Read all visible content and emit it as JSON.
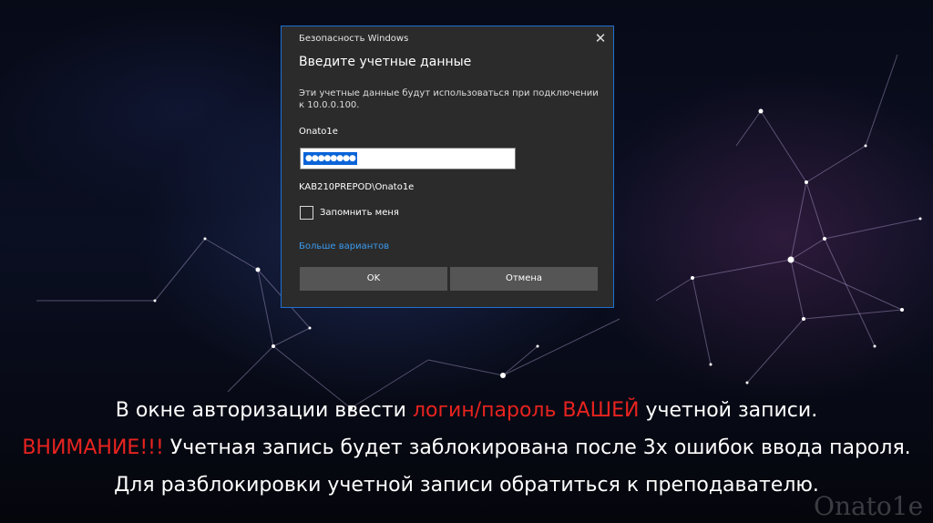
{
  "dialog": {
    "window_title": "Безопасность Windows",
    "close_glyph": "✕",
    "heading": "Введите учетные данные",
    "description": "Эти учетные данные будут использоваться при подключении к 10.0.0.100.",
    "username": "Onato1e",
    "password_masked": "●●●●●●●●",
    "domain_user": "KAB210PREPOD\\Onato1e",
    "remember_label": "Запомнить меня",
    "remember_checked": false,
    "more_options_link": "Больше вариантов",
    "ok_label": "OK",
    "cancel_label": "Отмена"
  },
  "caption": {
    "line1_a": "В окне авторизации ввести ",
    "line1_red": "логин/пароль ВАШЕЙ",
    "line1_b": " учетной записи.",
    "line2_red": "ВНИМАНИЕ!!!",
    "line2_b": " Учетная запись будет заблокирована после 3х ошибок ввода пароля.",
    "line3": "Для разблокировки учетной записи обратиться к преподавателю."
  },
  "watermark": "Onato1e",
  "colors": {
    "accent_red": "#e8231f",
    "link_blue": "#3a9bf0",
    "selection_blue": "#0a64d8",
    "dialog_bg": "#2b2b2b",
    "dialog_border": "#1f6fd1"
  }
}
